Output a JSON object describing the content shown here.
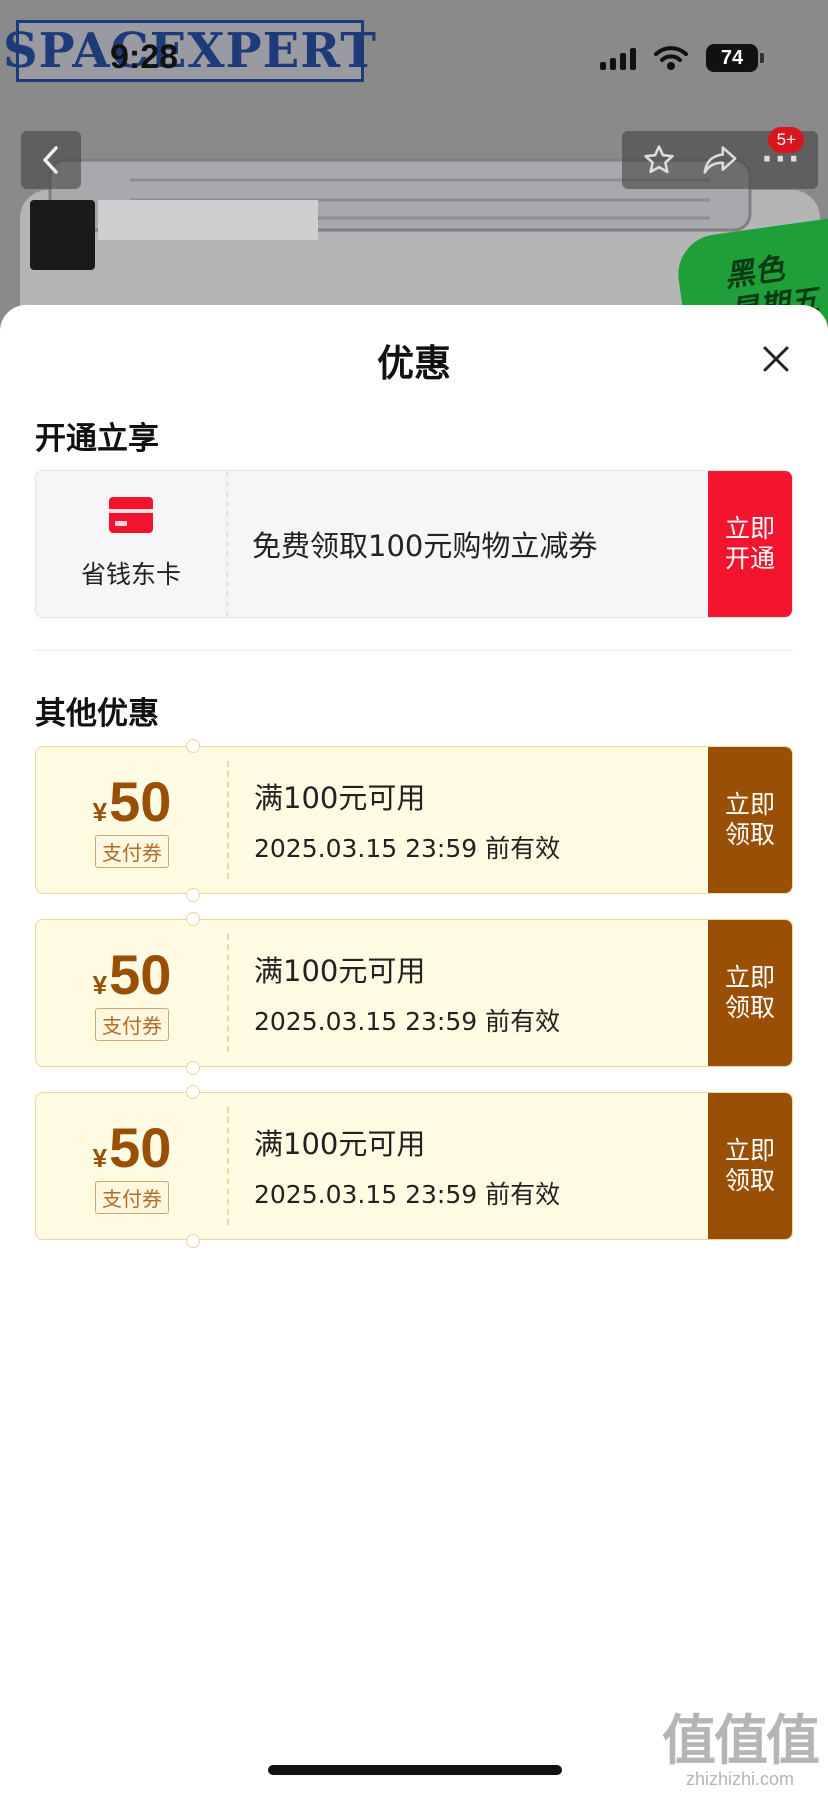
{
  "status_bar": {
    "time": "9:28",
    "battery": "74"
  },
  "background_page": {
    "brand": "SPACEXPERT",
    "badge_count": "5+",
    "sticker_text": "黑色\n星期五"
  },
  "sheet": {
    "title": "优惠",
    "section_membership": {
      "title": "开通立享",
      "card_name": "省钱东卡",
      "description": "免费领取100元购物立减券",
      "action": "立即\n开通"
    },
    "section_other": {
      "title": "其他优惠",
      "coupons": [
        {
          "currency": "¥",
          "amount": "50",
          "tag": "支付券",
          "condition": "满100元可用",
          "expiry": "2025.03.15 23:59 前有效",
          "action": "立即\n领取"
        },
        {
          "currency": "¥",
          "amount": "50",
          "tag": "支付券",
          "condition": "满100元可用",
          "expiry": "2025.03.15 23:59 前有效",
          "action": "立即\n领取"
        },
        {
          "currency": "¥",
          "amount": "50",
          "tag": "支付券",
          "condition": "满100元可用",
          "expiry": "2025.03.15 23:59 前有效",
          "action": "立即\n领取"
        }
      ]
    }
  },
  "watermark": {
    "logo": "值值值",
    "url": "zhizhizhi.com"
  },
  "colors": {
    "accent_red": "#f3152d",
    "coupon_brown": "#9a4f07",
    "coupon_bg": "#fffce3"
  }
}
